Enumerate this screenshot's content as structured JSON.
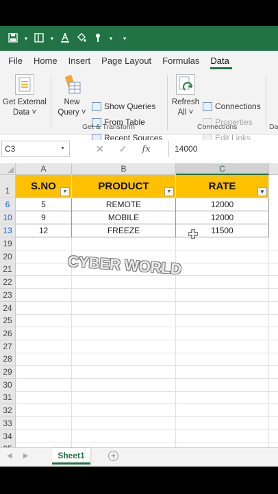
{
  "quick_access": {
    "items": [
      "save-icon",
      "dropdown",
      "layout-icon",
      "dropdown",
      "font-color-icon",
      "paint-icon",
      "brush-icon",
      "dropdown",
      "more-dropdown"
    ]
  },
  "tabs": [
    {
      "label": "File",
      "active": false
    },
    {
      "label": "Home",
      "active": false
    },
    {
      "label": "Insert",
      "active": false
    },
    {
      "label": "Page Layout",
      "active": false
    },
    {
      "label": "Formulas",
      "active": false
    },
    {
      "label": "Data",
      "active": true
    }
  ],
  "ribbon": {
    "get_external_data": {
      "line1": "Get External",
      "line2": "Data ˅"
    },
    "new_query": {
      "line1": "New",
      "line2": "Query ˅"
    },
    "show_queries": "Show Queries",
    "from_table": "From Table",
    "recent_sources": "Recent Sources",
    "get_transform_label": "Get & Transform",
    "refresh_all": {
      "line1": "Refresh",
      "line2": "All ˅"
    },
    "connections": "Connections",
    "properties": "Properties",
    "edit_links": "Edit Links",
    "connections_label": "Connections",
    "next_group_label": "Da"
  },
  "formula_bar": {
    "name_box": "C3",
    "fx_label": "fx",
    "value": "14000"
  },
  "grid": {
    "columns": [
      "A",
      "B",
      "C"
    ],
    "selected_column": "C",
    "header_row": {
      "row_num": "1",
      "cells": [
        "S.NO",
        "PRODUCT",
        "RATE"
      ]
    },
    "data_rows": [
      {
        "row_num": "6",
        "cells": [
          "5",
          "REMOTE",
          "12000"
        ]
      },
      {
        "row_num": "10",
        "cells": [
          "9",
          "MOBILE",
          "12000"
        ]
      },
      {
        "row_num": "13",
        "cells": [
          "12",
          "FREEZE",
          "11500"
        ]
      }
    ],
    "empty_rows": [
      "19",
      "20",
      "21",
      "22",
      "23",
      "24",
      "25",
      "26",
      "27",
      "28",
      "29",
      "30",
      "31",
      "32",
      "33",
      "34",
      "35"
    ],
    "watermark": "CYBER WORLD"
  },
  "sheets": {
    "active": "Sheet1"
  },
  "colors": {
    "excel_green": "#217346",
    "header_fill": "#ffc000",
    "filtered_row_number": "#1f5fbf"
  }
}
